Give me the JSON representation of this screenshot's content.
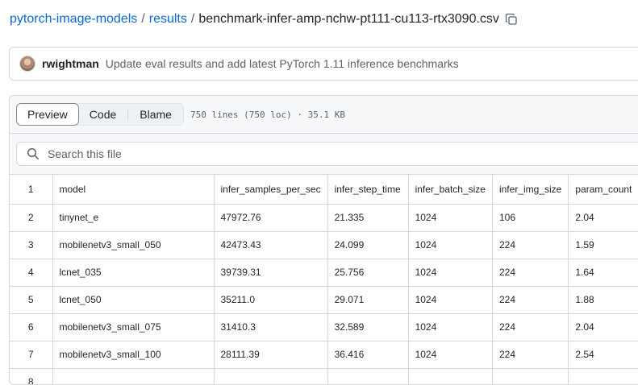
{
  "breadcrumb": {
    "repo": "pytorch-image-models",
    "sep1": "/",
    "folder": "results",
    "sep2": "/",
    "file": "benchmark-infer-amp-nchw-pt111-cu113-rtx3090.csv"
  },
  "commit": {
    "author": "rwightman",
    "message": "Update eval results and add latest PyTorch 1.11 inference benchmarks"
  },
  "viewer": {
    "tabs": [
      "Preview",
      "Code",
      "Blame"
    ],
    "active_tab": "Preview",
    "meta": "750 lines (750 loc) · 35.1 KB"
  },
  "search": {
    "placeholder": "Search this file"
  },
  "table": {
    "line_numbers": [
      "1",
      "2",
      "3",
      "4",
      "5",
      "6",
      "7",
      "8"
    ],
    "headers": [
      "model",
      "infer_samples_per_sec",
      "infer_step_time",
      "infer_batch_size",
      "infer_img_size",
      "param_count"
    ],
    "rows": [
      [
        "tinynet_e",
        "47972.76",
        "21.335",
        "1024",
        "106",
        "2.04"
      ],
      [
        "mobilenetv3_small_050",
        "42473.43",
        "24.099",
        "1024",
        "224",
        "1.59"
      ],
      [
        "lcnet_035",
        "39739.31",
        "25.756",
        "1024",
        "224",
        "1.64"
      ],
      [
        "lcnet_050",
        "35211.0",
        "29.071",
        "1024",
        "224",
        "1.88"
      ],
      [
        "mobilenetv3_small_075",
        "31410.3",
        "32.589",
        "1024",
        "224",
        "2.04"
      ],
      [
        "mobilenetv3_small_100",
        "28111.39",
        "36.416",
        "1024",
        "224",
        "2.54"
      ],
      [
        "",
        "",
        "",
        "",
        "",
        ""
      ]
    ]
  },
  "icons": {
    "copy": "copy-icon",
    "search": "search-icon"
  },
  "colors": {
    "link": "#0969da",
    "border": "#d1d9e0",
    "header_bg": "#f6f8fa"
  }
}
